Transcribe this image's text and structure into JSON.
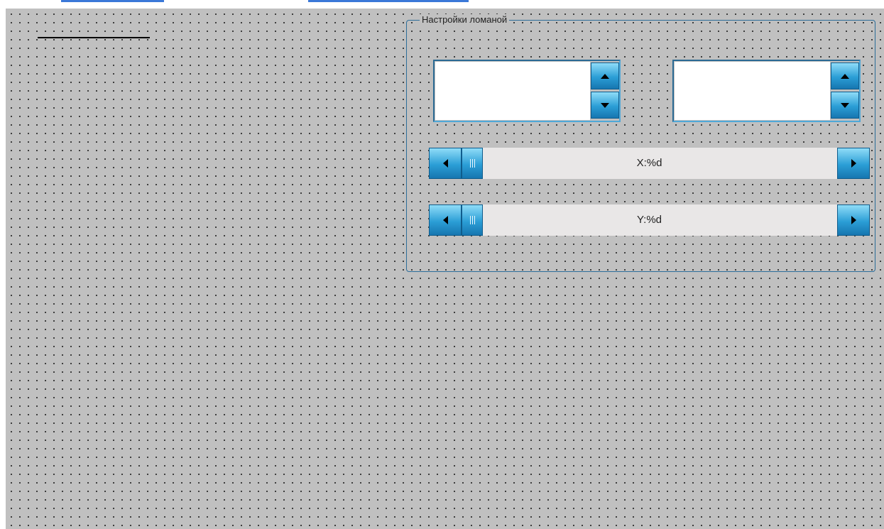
{
  "group": {
    "title": "Настройки ломаной"
  },
  "spinners": [
    {
      "value": ""
    },
    {
      "value": ""
    }
  ],
  "scrollbars": [
    {
      "label": "X:%d",
      "position": 0
    },
    {
      "label": "Y:%d",
      "position": 0
    }
  ],
  "colors": {
    "canvas": "#c0c0c0",
    "accent": "#2b9ed6",
    "frame": "#2d6e9a"
  },
  "icons": [
    "arrow-up-icon",
    "arrow-down-icon",
    "arrow-left-icon",
    "arrow-right-icon",
    "grip-icon"
  ]
}
